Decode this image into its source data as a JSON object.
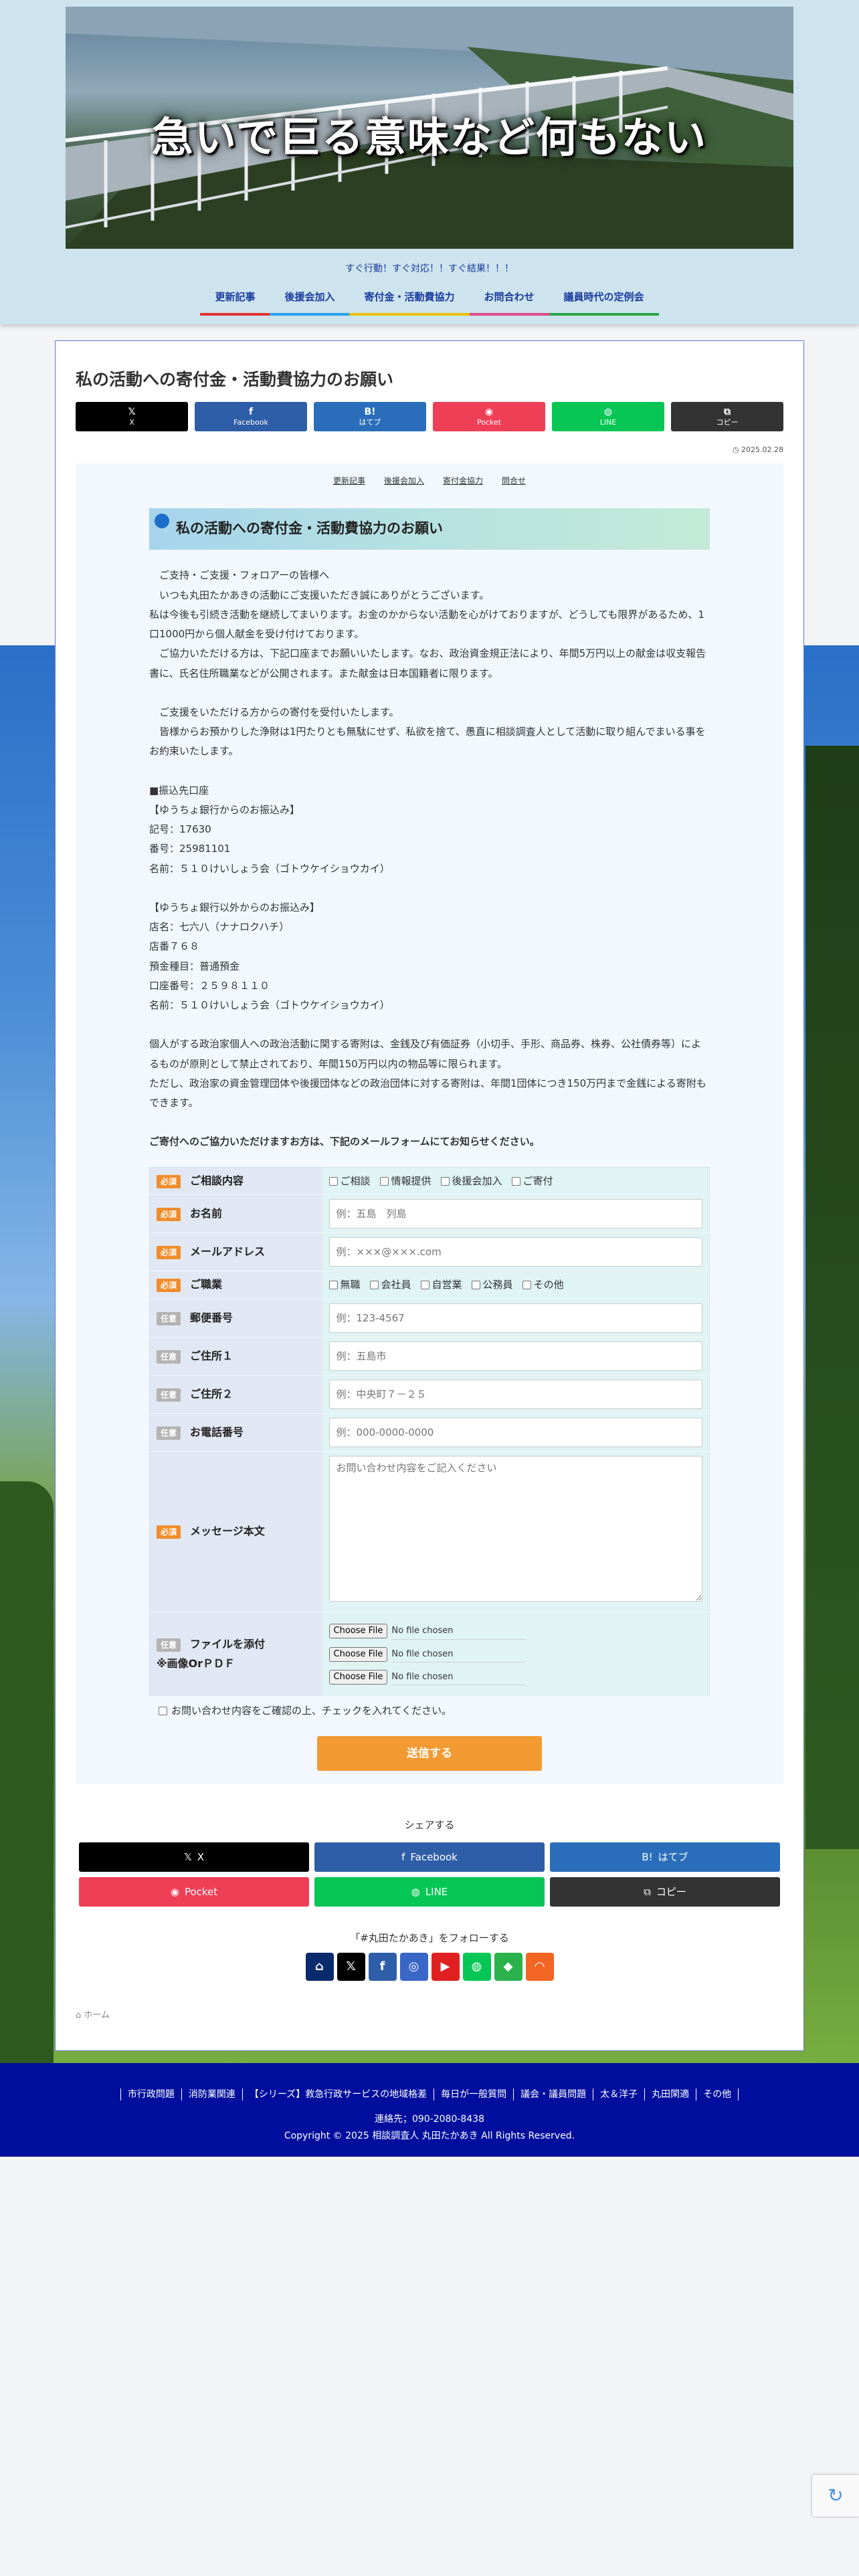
{
  "banner": {
    "text": "急いで巨る意味など何もない"
  },
  "tagline": "すぐ行動！すぐ対応！！すぐ結果！！！",
  "nav": [
    "更新記事",
    "後援会加入",
    "寄付金・活動費協力",
    "お問合わせ",
    "議員時代の定例会"
  ],
  "article": {
    "title": "私の活動への寄付金・活動費協力のお願い",
    "share_top": [
      {
        "icon": "𝕏",
        "label": "X"
      },
      {
        "icon": "f",
        "label": "Facebook"
      },
      {
        "icon": "B!",
        "label": "はてブ"
      },
      {
        "icon": "◉",
        "label": "Pocket"
      },
      {
        "icon": "◍",
        "label": "LINE"
      },
      {
        "icon": "⧉",
        "label": "コピー"
      }
    ],
    "date": "2025.02.28",
    "sub_links": [
      "更新記事",
      "後援会加入",
      "寄付金協力",
      "問合せ"
    ],
    "heading": "私の活動への寄付金・活動費協力のお願い",
    "paragraphs": [
      "　ご支持・ご支援・フォロアーの皆様へ",
      "　いつも丸田たかあきの活動にご支援いただき誠にありがとうございます。",
      "私は今後も引続き活動を継続してまいります。お金のかからない活動を心がけておりますが、どうしても限界があるため、1口1000円から個人献金を受け付けております。",
      "　ご協力いただける方は、下記口座までお願いいたします。なお、政治資金規正法により、年間5万円以上の献金は収支報告書に、氏名住所職業などが公開されます。また献金は日本国籍者に限ります。",
      "",
      "　ご支援をいただける方からの寄付を受付いたします。",
      "　皆様からお預かりした浄財は1円たりとも無駄にせず、私欲を捨て、愚直に相談調査人として活動に取り組んでまいる事をお約束いたします。",
      "",
      "■振込先口座",
      "【ゆうちょ銀行からのお振込み】",
      "記号：17630",
      "番号：25981101",
      "名前：５１０けいしょう会（ゴトウケイショウカイ）",
      "",
      "【ゆうちょ銀行以外からのお振込み】",
      "店名：七六八（ナナロクハチ）",
      "店番７６８",
      "預金種目：普通預金",
      "口座番号：２５９８１１０",
      "名前：５１０けいしょう会（ゴトウケイショウカイ）",
      "",
      "個人がする政治家個人への政治活動に関する寄附は、金銭及び有価証券（小切手、手形、商品券、株券、公社債券等）によるものが原則として禁止されており、年間150万円以内の物品等に限られます。",
      "ただし、政治家の資金管理団体や後援団体などの政治団体に対する寄附は、年間1団体につき150万円まで金銭による寄附もできます。",
      ""
    ],
    "form_intro": "ご寄付へのご協力いただけますお方は、下記のメールフォームにてお知らせください。"
  },
  "form": {
    "required_label": "必須",
    "optional_label": "任意",
    "inquiry": {
      "label": "ご相談内容",
      "options": [
        "ご相談",
        "情報提供",
        "後援会加入",
        "ご寄付"
      ]
    },
    "name": {
      "label": "お名前",
      "placeholder": "例：五島　列島"
    },
    "email": {
      "label": "メールアドレス",
      "placeholder": "例：×××@×××.com"
    },
    "job": {
      "label": "ご職業",
      "options": [
        "無職",
        "会社員",
        "自営業",
        "公務員",
        "その他"
      ]
    },
    "zip": {
      "label": "郵便番号",
      "placeholder": "例：123-4567"
    },
    "addr1": {
      "label": "ご住所１",
      "placeholder": "例：五島市"
    },
    "addr2": {
      "label": "ご住所２",
      "placeholder": "例：中央町７－２５"
    },
    "tel": {
      "label": "お電話番号",
      "placeholder": "例：000-0000-0000"
    },
    "message": {
      "label": "メッセージ本文",
      "placeholder": "お問い合わせ内容をご記入ください"
    },
    "file": {
      "label": "ファイルを添付",
      "note": "※画像OrＰＤＦ",
      "button": "Choose File",
      "status": "No file chosen"
    },
    "confirm": "お問い合わせ内容をご確認の上、チェックを入れてください。",
    "submit": "送信する"
  },
  "share_bottom": {
    "title": "シェアする",
    "buttons": [
      {
        "icon": "𝕏",
        "label": "X",
        "color": "#000000"
      },
      {
        "icon": "f",
        "label": "Facebook",
        "color": "#2f5ea8"
      },
      {
        "icon": "B!",
        "label": "はてブ",
        "color": "#2a6ebb"
      },
      {
        "icon": "◉",
        "label": "Pocket",
        "color": "#ef3f56"
      },
      {
        "icon": "◍",
        "label": "LINE",
        "color": "#06c755"
      },
      {
        "icon": "⧉",
        "label": "コピー",
        "color": "#333333"
      }
    ]
  },
  "follow": {
    "title": "「#丸田たかあき」をフォローする",
    "icons": [
      {
        "name": "home-icon",
        "glyph": "⌂",
        "color": "#0a2a6e"
      },
      {
        "name": "x-icon",
        "glyph": "𝕏",
        "color": "#000000"
      },
      {
        "name": "facebook-icon",
        "glyph": "f",
        "color": "#2f5ea8"
      },
      {
        "name": "instagram-icon",
        "glyph": "◎",
        "color": "#3a66c7"
      },
      {
        "name": "youtube-icon",
        "glyph": "▶",
        "color": "#e02020"
      },
      {
        "name": "line-icon",
        "glyph": "◍",
        "color": "#06c755"
      },
      {
        "name": "feedly-icon",
        "glyph": "◆",
        "color": "#2bb24c"
      },
      {
        "name": "rss-icon",
        "glyph": "◠",
        "color": "#f26522"
      }
    ]
  },
  "breadcrumb": {
    "icon": "⌂",
    "label": "ホーム"
  },
  "footer": {
    "links": [
      "市行政問題",
      "消防業関連",
      "【シリーズ】救急行政サービスの地域格差",
      "毎日が一般質問",
      "議会・議員問題",
      "太＆洋子",
      "丸田閑適",
      "その他"
    ],
    "contact": "連絡先；090-2080-8438",
    "copyright": "Copyright © 2025 相談調査人 丸田たかあき All Rights Reserved."
  }
}
